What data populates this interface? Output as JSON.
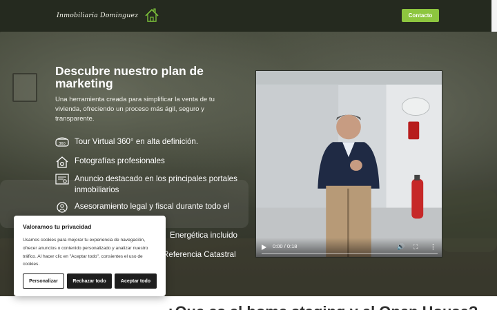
{
  "header": {
    "logo_text": "Inmobiliaria Dominguez",
    "contact_label": "Contacto"
  },
  "hero": {
    "title": "Descubre nuestro plan de marketing",
    "subtitle": "Una herramienta creada para simplificar la venta de tu vivienda, ofreciendo un proceso más ágil, seguro y transparente.",
    "features": [
      {
        "icon": "vr-360-icon",
        "text": "Tour Virtual 360° en alta definición."
      },
      {
        "icon": "house-camera-icon",
        "text": "Fotografías profesionales"
      },
      {
        "icon": "listing-icon",
        "text": "Anuncio destacado en los principales portales inmobiliarios"
      },
      {
        "icon": "advisor-icon",
        "text": "Asesoramiento legal y fiscal durante todo el"
      },
      {
        "icon": "energy-certificate-icon",
        "text": "Energética incluido"
      },
      {
        "icon": "cadastral-icon",
        "text": "Referencia Catastral"
      }
    ]
  },
  "video": {
    "time": "0:00 / 0:18",
    "progress": 0
  },
  "next_section": {
    "title": "¿Que es el home staging y el Open House?"
  },
  "cookie_banner": {
    "title": "Valoramos tu privacidad",
    "body": "Usamos cookies para mejorar tu experiencia de navegación, ofrecer anuncios o contenido personalizado y analizar nuestro tráfico. Al hacer clic en \"Aceptar todo\", consientes el uso de cookies.",
    "customize_label": "Personalizar",
    "reject_label": "Rechazar todo",
    "accept_label": "Aceptar todo"
  },
  "colors": {
    "header_bg": "#252a1f",
    "accent": "#8dc63f",
    "cookie_button_dark": "#1e1e1e"
  }
}
